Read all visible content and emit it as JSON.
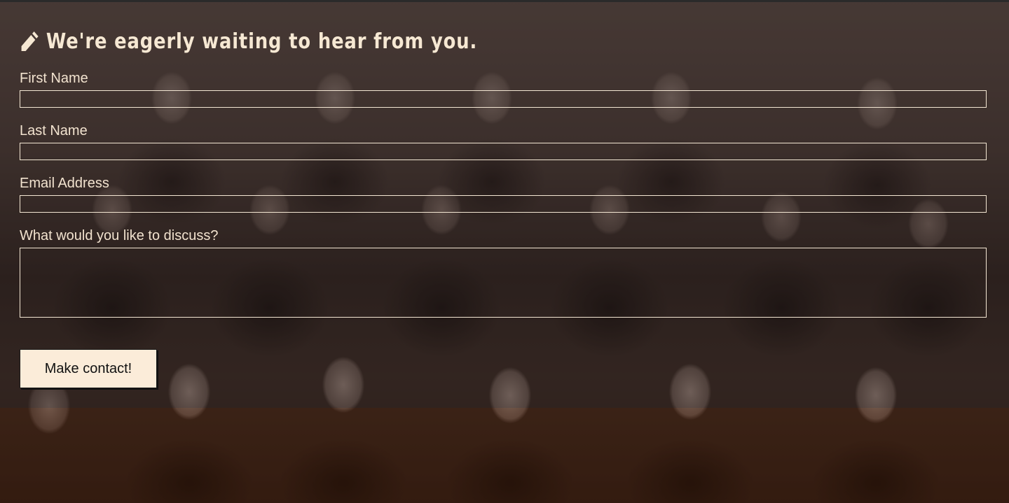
{
  "colors": {
    "overlay": "#28201e",
    "text": "#f6e8d3",
    "input_border": "#f4e7d4",
    "button_bg": "#fbecd9",
    "button_text": "#111111"
  },
  "form": {
    "heading_icon": "pencil-icon",
    "heading": "We're eagerly waiting to hear from you.",
    "fields": {
      "first_name": {
        "label": "First Name",
        "value": ""
      },
      "last_name": {
        "label": "Last Name",
        "value": ""
      },
      "email": {
        "label": "Email Address",
        "value": ""
      },
      "message": {
        "label": "What would you like to discuss?",
        "value": ""
      }
    },
    "submit_label": "Make contact!"
  }
}
